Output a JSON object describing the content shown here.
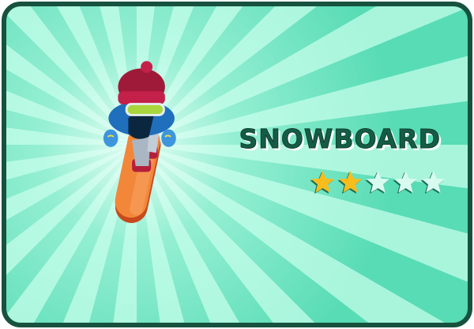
{
  "game": {
    "title": "SNOWBOARD",
    "rating": 2,
    "max_rating": 5
  },
  "colors": {
    "border": "#17523f",
    "star_filled": "#f7bd1c",
    "star_empty": "#d8fbef",
    "title": "#155c45"
  }
}
